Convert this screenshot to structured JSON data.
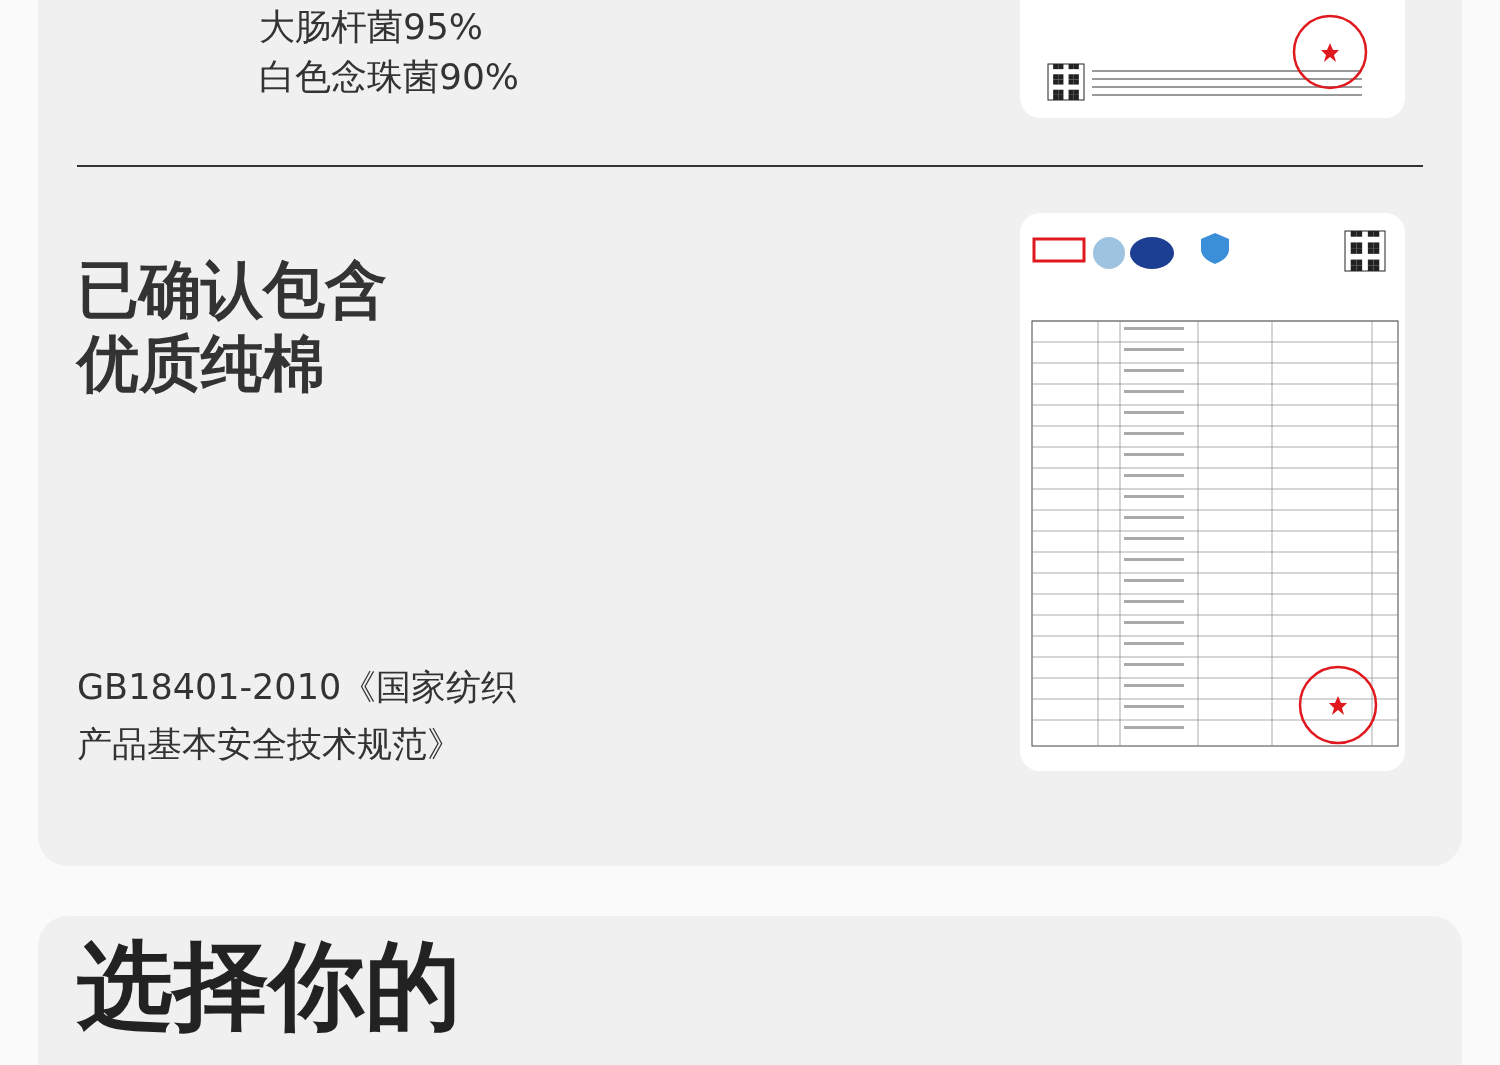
{
  "top_section": {
    "lines": [
      "大肠杆菌95%",
      "白色念珠菌90%"
    ]
  },
  "certification": {
    "heading": [
      "已确认包含",
      "优质纯棉"
    ],
    "standard": [
      "GB18401-2010《国家纺织",
      "产品基本安全技术规范》"
    ]
  },
  "next_section": {
    "heading": "选择你的"
  }
}
